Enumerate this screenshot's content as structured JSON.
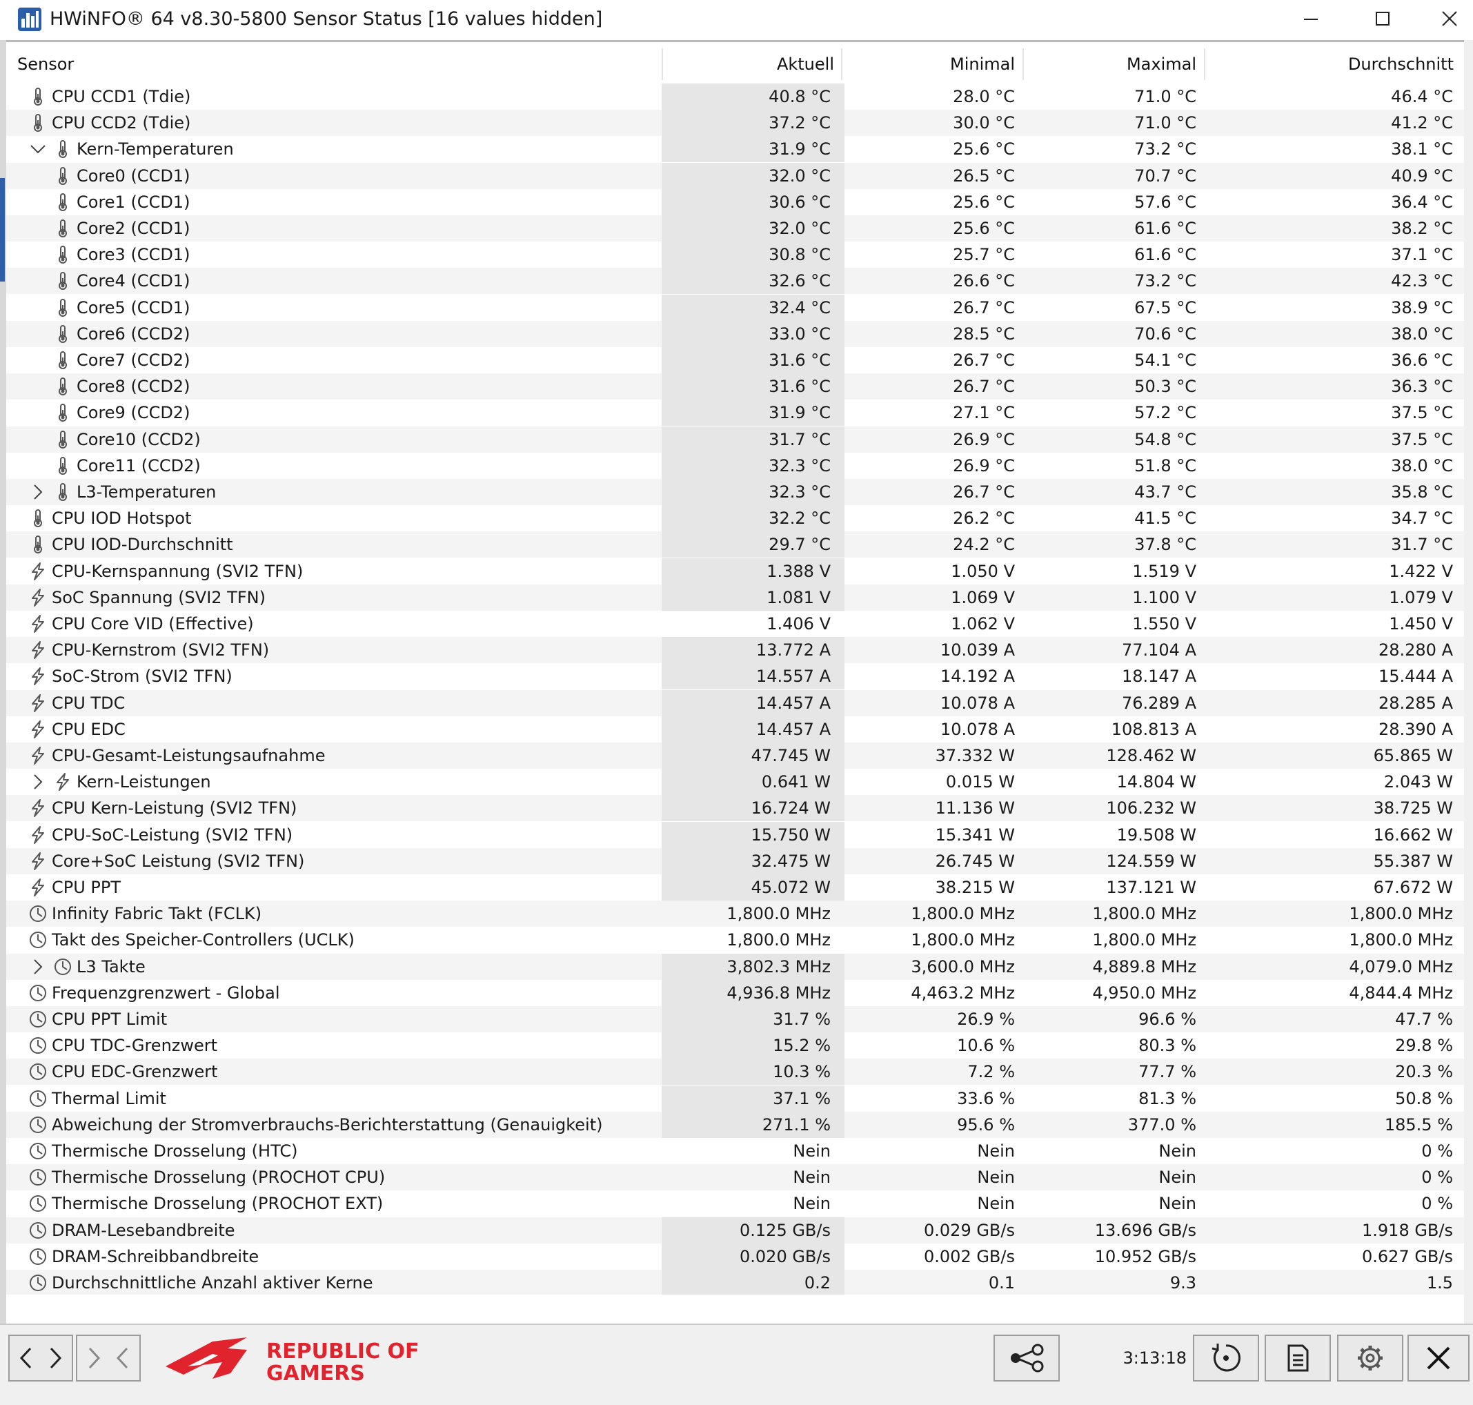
{
  "window": {
    "title": "HWiNFO® 64 v8.30-5800 Sensor Status [16 values hidden]",
    "icon": "hwinfo-app-icon"
  },
  "columns": {
    "sensor": "Sensor",
    "current": "Aktuell",
    "minimum": "Minimal",
    "maximum": "Maximal",
    "average": "Durchschnitt"
  },
  "rows": [
    {
      "name": "CPU CCD1 (Tdie)",
      "cur": "40.8 °C",
      "min": "28.0 °C",
      "max": "71.0 °C",
      "avg": "46.4 °C",
      "icon": "thermometer-icon",
      "indent": 1,
      "shaded": true
    },
    {
      "name": "CPU CCD2 (Tdie)",
      "cur": "37.2 °C",
      "min": "30.0 °C",
      "max": "71.0 °C",
      "avg": "41.2 °C",
      "icon": "thermometer-icon",
      "indent": 1,
      "shaded": true
    },
    {
      "name": "Kern-Temperaturen",
      "cur": "31.9 °C",
      "min": "25.6 °C",
      "max": "73.2 °C",
      "avg": "38.1 °C",
      "icon": "thermometer-icon",
      "indent": 2,
      "expander": "expanded",
      "shaded": true
    },
    {
      "name": "Core0 (CCD1)",
      "cur": "32.0 °C",
      "min": "26.5 °C",
      "max": "70.7 °C",
      "avg": "40.9 °C",
      "icon": "thermometer-icon",
      "indent": 2,
      "shaded": true
    },
    {
      "name": "Core1 (CCD1)",
      "cur": "30.6 °C",
      "min": "25.6 °C",
      "max": "57.6 °C",
      "avg": "36.4 °C",
      "icon": "thermometer-icon",
      "indent": 2,
      "shaded": true
    },
    {
      "name": "Core2 (CCD1)",
      "cur": "32.0 °C",
      "min": "25.6 °C",
      "max": "61.6 °C",
      "avg": "38.2 °C",
      "icon": "thermometer-icon",
      "indent": 2,
      "shaded": true
    },
    {
      "name": "Core3 (CCD1)",
      "cur": "30.8 °C",
      "min": "25.7 °C",
      "max": "61.6 °C",
      "avg": "37.1 °C",
      "icon": "thermometer-icon",
      "indent": 2,
      "shaded": true
    },
    {
      "name": "Core4 (CCD1)",
      "cur": "32.6 °C",
      "min": "26.6 °C",
      "max": "73.2 °C",
      "avg": "42.3 °C",
      "icon": "thermometer-icon",
      "indent": 2,
      "shaded": true
    },
    {
      "name": "Core5 (CCD1)",
      "cur": "32.4 °C",
      "min": "26.7 °C",
      "max": "67.5 °C",
      "avg": "38.9 °C",
      "icon": "thermometer-icon",
      "indent": 2,
      "shaded": true
    },
    {
      "name": "Core6 (CCD2)",
      "cur": "33.0 °C",
      "min": "28.5 °C",
      "max": "70.6 °C",
      "avg": "38.0 °C",
      "icon": "thermometer-icon",
      "indent": 2,
      "shaded": true
    },
    {
      "name": "Core7 (CCD2)",
      "cur": "31.6 °C",
      "min": "26.7 °C",
      "max": "54.1 °C",
      "avg": "36.6 °C",
      "icon": "thermometer-icon",
      "indent": 2,
      "shaded": true
    },
    {
      "name": "Core8 (CCD2)",
      "cur": "31.6 °C",
      "min": "26.7 °C",
      "max": "50.3 °C",
      "avg": "36.3 °C",
      "icon": "thermometer-icon",
      "indent": 2,
      "shaded": true
    },
    {
      "name": "Core9 (CCD2)",
      "cur": "31.9 °C",
      "min": "27.1 °C",
      "max": "57.2 °C",
      "avg": "37.5 °C",
      "icon": "thermometer-icon",
      "indent": 2,
      "shaded": true
    },
    {
      "name": "Core10 (CCD2)",
      "cur": "31.7 °C",
      "min": "26.9 °C",
      "max": "54.8 °C",
      "avg": "37.5 °C",
      "icon": "thermometer-icon",
      "indent": 2,
      "shaded": true
    },
    {
      "name": "Core11 (CCD2)",
      "cur": "32.3 °C",
      "min": "26.9 °C",
      "max": "51.8 °C",
      "avg": "38.0 °C",
      "icon": "thermometer-icon",
      "indent": 2,
      "shaded": true
    },
    {
      "name": "L3-Temperaturen",
      "cur": "32.3 °C",
      "min": "26.7 °C",
      "max": "43.7 °C",
      "avg": "35.8 °C",
      "icon": "thermometer-icon",
      "indent": 2,
      "expander": "collapsed",
      "shaded": true
    },
    {
      "name": "CPU IOD Hotspot",
      "cur": "32.2 °C",
      "min": "26.2 °C",
      "max": "41.5 °C",
      "avg": "34.7 °C",
      "icon": "thermometer-icon",
      "indent": 1,
      "shaded": true
    },
    {
      "name": "CPU IOD-Durchschnitt",
      "cur": "29.7 °C",
      "min": "24.2 °C",
      "max": "37.8 °C",
      "avg": "31.7 °C",
      "icon": "thermometer-icon",
      "indent": 1,
      "shaded": true
    },
    {
      "name": "CPU-Kernspannung (SVI2 TFN)",
      "cur": "1.388 V",
      "min": "1.050 V",
      "max": "1.519 V",
      "avg": "1.422 V",
      "icon": "lightning-icon",
      "indent": 1,
      "shaded": true
    },
    {
      "name": "SoC Spannung (SVI2 TFN)",
      "cur": "1.081 V",
      "min": "1.069 V",
      "max": "1.100 V",
      "avg": "1.079 V",
      "icon": "lightning-icon",
      "indent": 1,
      "shaded": true
    },
    {
      "name": "CPU Core VID (Effective)",
      "cur": "1.406 V",
      "min": "1.062 V",
      "max": "1.550 V",
      "avg": "1.450 V",
      "icon": "lightning-icon",
      "indent": 1,
      "shaded": false
    },
    {
      "name": "CPU-Kernstrom (SVI2 TFN)",
      "cur": "13.772 A",
      "min": "10.039 A",
      "max": "77.104 A",
      "avg": "28.280 A",
      "icon": "lightning-icon",
      "indent": 1,
      "shaded": true
    },
    {
      "name": "SoC-Strom (SVI2 TFN)",
      "cur": "14.557 A",
      "min": "14.192 A",
      "max": "18.147 A",
      "avg": "15.444 A",
      "icon": "lightning-icon",
      "indent": 1,
      "shaded": true
    },
    {
      "name": "CPU TDC",
      "cur": "14.457 A",
      "min": "10.078 A",
      "max": "76.289 A",
      "avg": "28.285 A",
      "icon": "lightning-icon",
      "indent": 1,
      "shaded": true
    },
    {
      "name": "CPU EDC",
      "cur": "14.457 A",
      "min": "10.078 A",
      "max": "108.813 A",
      "avg": "28.390 A",
      "icon": "lightning-icon",
      "indent": 1,
      "shaded": true
    },
    {
      "name": "CPU-Gesamt-Leistungsaufnahme",
      "cur": "47.745 W",
      "min": "37.332 W",
      "max": "128.462 W",
      "avg": "65.865 W",
      "icon": "lightning-icon",
      "indent": 1,
      "shaded": true
    },
    {
      "name": "Kern-Leistungen",
      "cur": "0.641 W",
      "min": "0.015 W",
      "max": "14.804 W",
      "avg": "2.043 W",
      "icon": "lightning-icon",
      "indent": 2,
      "expander": "collapsed",
      "shaded": true
    },
    {
      "name": "CPU Kern-Leistung (SVI2 TFN)",
      "cur": "16.724 W",
      "min": "11.136 W",
      "max": "106.232 W",
      "avg": "38.725 W",
      "icon": "lightning-icon",
      "indent": 1,
      "shaded": true
    },
    {
      "name": "CPU-SoC-Leistung (SVI2 TFN)",
      "cur": "15.750 W",
      "min": "15.341 W",
      "max": "19.508 W",
      "avg": "16.662 W",
      "icon": "lightning-icon",
      "indent": 1,
      "shaded": true
    },
    {
      "name": "Core+SoC Leistung (SVI2 TFN)",
      "cur": "32.475 W",
      "min": "26.745 W",
      "max": "124.559 W",
      "avg": "55.387 W",
      "icon": "lightning-icon",
      "indent": 1,
      "shaded": true
    },
    {
      "name": "CPU PPT",
      "cur": "45.072 W",
      "min": "38.215 W",
      "max": "137.121 W",
      "avg": "67.672 W",
      "icon": "lightning-icon",
      "indent": 1,
      "shaded": true
    },
    {
      "name": "Infinity Fabric Takt (FCLK)",
      "cur": "1,800.0 MHz",
      "min": "1,800.0 MHz",
      "max": "1,800.0 MHz",
      "avg": "1,800.0 MHz",
      "icon": "clock-icon",
      "indent": 1,
      "shaded": false
    },
    {
      "name": "Takt des Speicher-Controllers (UCLK)",
      "cur": "1,800.0 MHz",
      "min": "1,800.0 MHz",
      "max": "1,800.0 MHz",
      "avg": "1,800.0 MHz",
      "icon": "clock-icon",
      "indent": 1,
      "shaded": false
    },
    {
      "name": "L3 Takte",
      "cur": "3,802.3 MHz",
      "min": "3,600.0 MHz",
      "max": "4,889.8 MHz",
      "avg": "4,079.0 MHz",
      "icon": "clock-icon",
      "indent": 2,
      "expander": "collapsed",
      "shaded": true
    },
    {
      "name": "Frequenzgrenzwert - Global",
      "cur": "4,936.8 MHz",
      "min": "4,463.2 MHz",
      "max": "4,950.0 MHz",
      "avg": "4,844.4 MHz",
      "icon": "clock-icon",
      "indent": 1,
      "shaded": true
    },
    {
      "name": "CPU PPT Limit",
      "cur": "31.7 %",
      "min": "26.9 %",
      "max": "96.6 %",
      "avg": "47.7 %",
      "icon": "clock-icon",
      "indent": 1,
      "shaded": true
    },
    {
      "name": "CPU TDC-Grenzwert",
      "cur": "15.2 %",
      "min": "10.6 %",
      "max": "80.3 %",
      "avg": "29.8 %",
      "icon": "clock-icon",
      "indent": 1,
      "shaded": true
    },
    {
      "name": "CPU EDC-Grenzwert",
      "cur": "10.3 %",
      "min": "7.2 %",
      "max": "77.7 %",
      "avg": "20.3 %",
      "icon": "clock-icon",
      "indent": 1,
      "shaded": true
    },
    {
      "name": "Thermal Limit",
      "cur": "37.1 %",
      "min": "33.6 %",
      "max": "81.3 %",
      "avg": "50.8 %",
      "icon": "clock-icon",
      "indent": 1,
      "shaded": true
    },
    {
      "name": "Abweichung der Stromverbrauchs-Berichterstattung (Genauigkeit)",
      "cur": "271.1 %",
      "min": "95.6 %",
      "max": "377.0 %",
      "avg": "185.5 %",
      "icon": "clock-icon",
      "indent": 1,
      "shaded": true
    },
    {
      "name": "Thermische Drosselung (HTC)",
      "cur": "Nein",
      "min": "Nein",
      "max": "Nein",
      "avg": "0 %",
      "icon": "clock-icon",
      "indent": 1,
      "shaded": false
    },
    {
      "name": "Thermische Drosselung (PROCHOT CPU)",
      "cur": "Nein",
      "min": "Nein",
      "max": "Nein",
      "avg": "0 %",
      "icon": "clock-icon",
      "indent": 1,
      "shaded": false
    },
    {
      "name": "Thermische Drosselung (PROCHOT EXT)",
      "cur": "Nein",
      "min": "Nein",
      "max": "Nein",
      "avg": "0 %",
      "icon": "clock-icon",
      "indent": 1,
      "shaded": false
    },
    {
      "name": "DRAM-Lesebandbreite",
      "cur": "0.125 GB/s",
      "min": "0.029 GB/s",
      "max": "13.696 GB/s",
      "avg": "1.918 GB/s",
      "icon": "clock-icon",
      "indent": 1,
      "shaded": true
    },
    {
      "name": "DRAM-Schreibbandbreite",
      "cur": "0.020 GB/s",
      "min": "0.002 GB/s",
      "max": "10.952 GB/s",
      "avg": "0.627 GB/s",
      "icon": "clock-icon",
      "indent": 1,
      "shaded": true
    },
    {
      "name": "Durchschnittliche Anzahl aktiver Kerne",
      "cur": "0.2",
      "min": "0.1",
      "max": "9.3",
      "avg": "1.5",
      "icon": "clock-icon",
      "indent": 1,
      "shaded": true
    }
  ],
  "bottom": {
    "logo_line1": "REPUBLIC OF",
    "logo_line2": "GAMERS",
    "timer": "3:13:18"
  },
  "colors": {
    "row_alt": "#f4f4f4",
    "value_highlight": "#e6e6e6",
    "rog_red": "#e0232d"
  }
}
